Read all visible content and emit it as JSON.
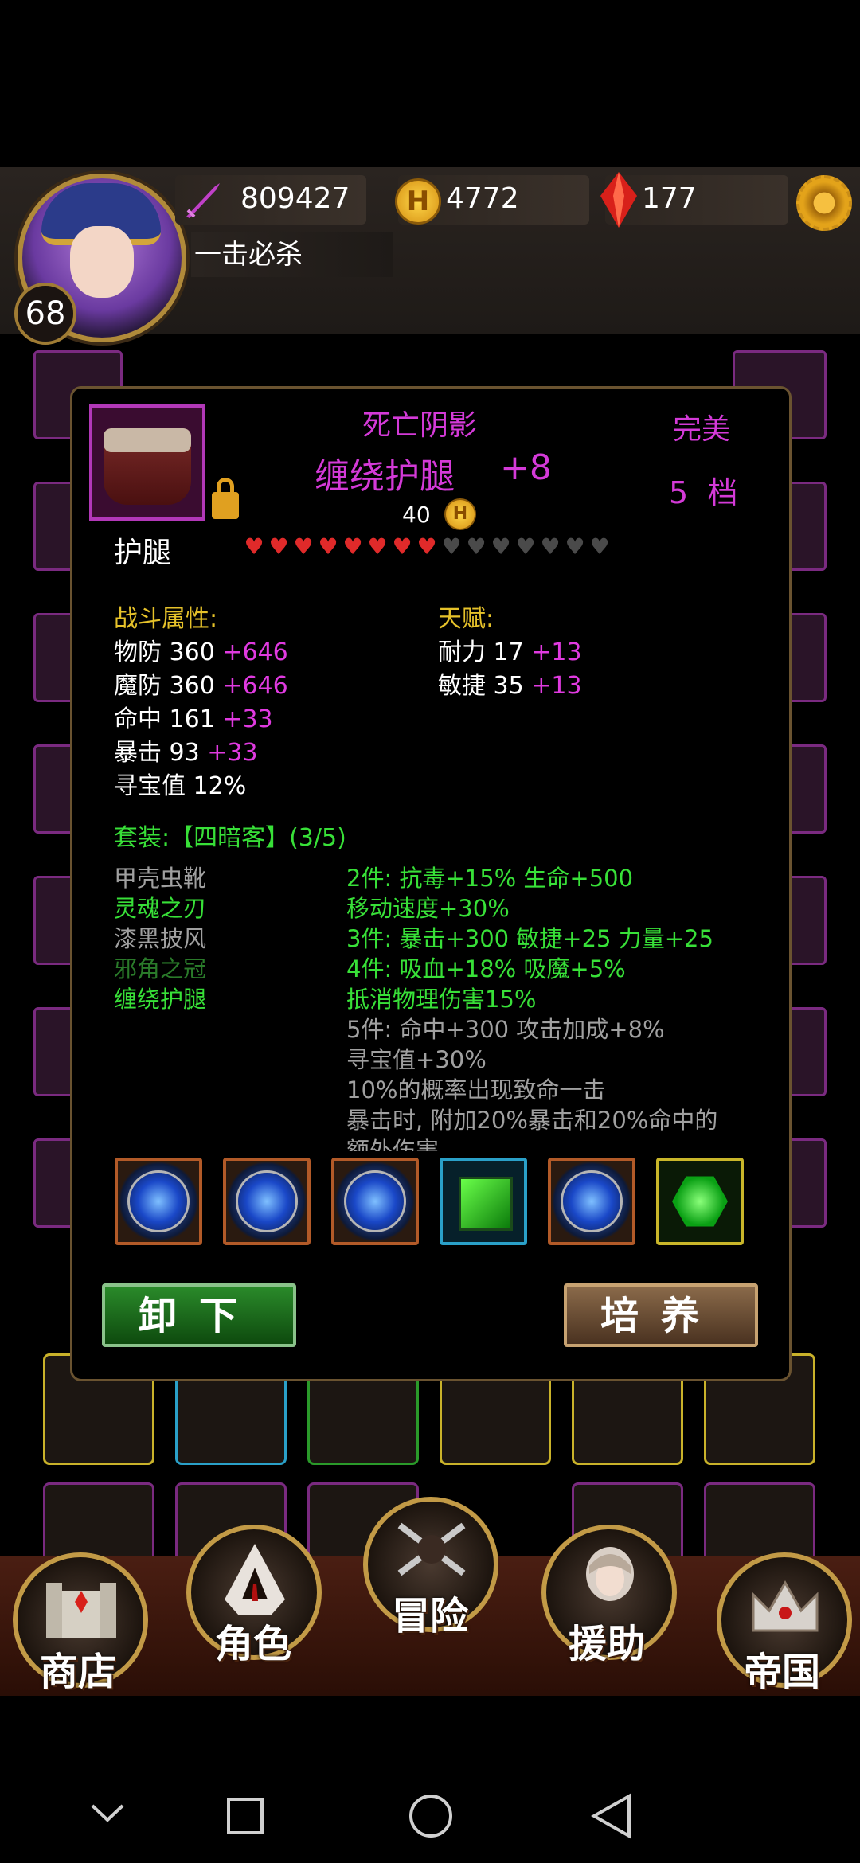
{
  "header": {
    "player_level": "68",
    "attack_power": "809427",
    "gold": "4772",
    "gems": "177",
    "title": "一击必杀",
    "coin_glyph": "H"
  },
  "item": {
    "name_prefix": "死亡阴影",
    "name": "缠绕护腿",
    "enhance": "+8",
    "quality": "完美",
    "tier": "5",
    "tier_unit": "档",
    "price": "40",
    "slot_type": "护腿",
    "hearts_filled": 8,
    "hearts_total": 15
  },
  "combat": {
    "heading": "战斗属性:",
    "stats": [
      {
        "label": "物防 360",
        "bonus": "+646"
      },
      {
        "label": "魔防 360",
        "bonus": "+646"
      },
      {
        "label": "命中 161",
        "bonus": "+33"
      },
      {
        "label": "暴击 93",
        "bonus": "+33"
      },
      {
        "label": "寻宝值 12%",
        "bonus": ""
      }
    ]
  },
  "talent": {
    "heading": "天赋:",
    "stats": [
      {
        "label": "耐力 17",
        "bonus": "+13"
      },
      {
        "label": "敏捷 35",
        "bonus": "+13"
      }
    ]
  },
  "set": {
    "heading": "套装:【四暗客】(3/5)",
    "pieces": [
      {
        "name": "甲壳虫靴",
        "owned": false
      },
      {
        "name": "灵魂之刃",
        "owned": true
      },
      {
        "name": "漆黑披风",
        "owned": false
      },
      {
        "name": "邪角之冠",
        "owned": false
      },
      {
        "name": "缠绕护腿",
        "owned": true
      }
    ],
    "bonuses": [
      {
        "text": "2件: 抗毒+15% 生命+500",
        "active": true
      },
      {
        "text": "移动速度+30%",
        "active": true
      },
      {
        "text": "3件: 暴击+300 敏捷+25 力量+25",
        "active": true
      },
      {
        "text": "4件: 吸血+18% 吸魔+5%",
        "active": true
      },
      {
        "text": "抵消物理伤害15%",
        "active": true
      },
      {
        "text": "5件: 命中+300 攻击加成+8%",
        "active": false
      },
      {
        "text": "寻宝值+30%",
        "active": false
      },
      {
        "text": "10%的概率出现致命一击",
        "active": false
      },
      {
        "text": "暴击时, 附加20%暴击和20%命中的",
        "active": false
      },
      {
        "text": "额外伤害",
        "active": false
      }
    ]
  },
  "buttons": {
    "unequip": "卸下",
    "cultivate": "培养"
  },
  "nav": {
    "shop": "商店",
    "character": "角色",
    "adventure": "冒险",
    "assist": "援助",
    "empire": "帝国"
  },
  "colors": {
    "magenta": "#d43ad8",
    "gold": "#e6c22a",
    "green": "#38e038",
    "grey": "#a0a0a0"
  }
}
